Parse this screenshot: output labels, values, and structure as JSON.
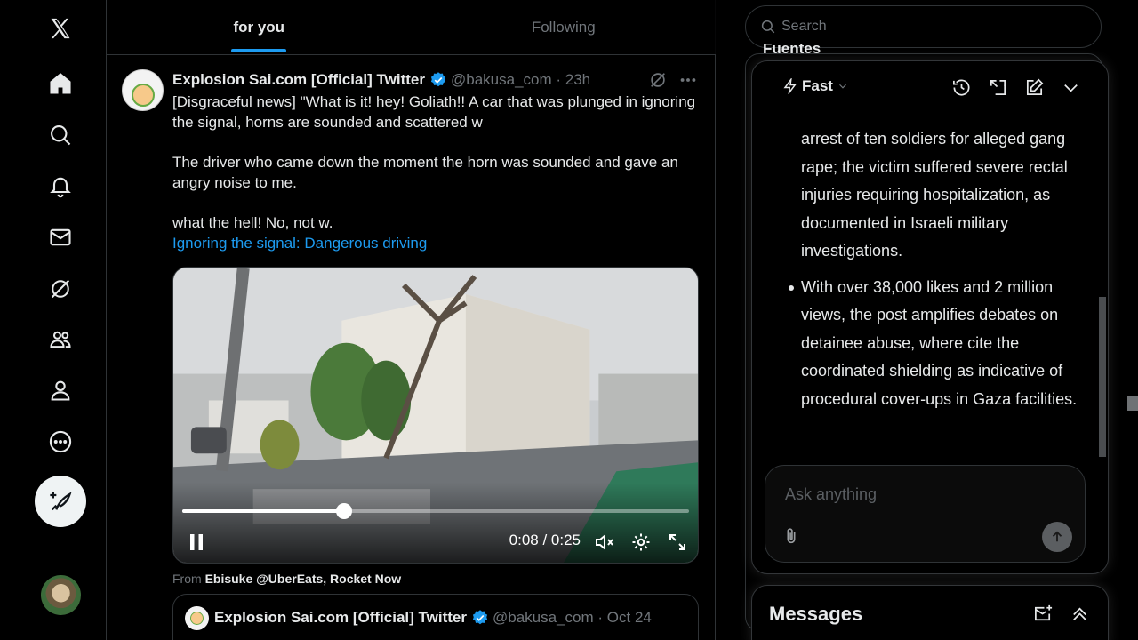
{
  "nav": {
    "items": [
      {
        "name": "x-logo-icon"
      },
      {
        "name": "home-icon"
      },
      {
        "name": "explore-icon"
      },
      {
        "name": "notifications-icon"
      },
      {
        "name": "messages-icon"
      },
      {
        "name": "grok-icon"
      },
      {
        "name": "communities-icon"
      },
      {
        "name": "profile-icon"
      },
      {
        "name": "more-icon"
      }
    ],
    "compose_icon": "feather-plus-icon"
  },
  "feed": {
    "tabs": [
      {
        "label": "for you",
        "active": true
      },
      {
        "label": "Following",
        "active": false
      }
    ]
  },
  "post": {
    "author_name": "Explosion Sai.com [Official] Twitter",
    "handle_time": "@bakusa_com · 23h",
    "paragraphs": [
      "[Disgraceful news] \"What is it! hey! Goliath!! A car that was plunged in ignoring the signal, horns are sounded and scattered w",
      "The driver who came down the moment the horn was sounded and gave an angry noise to me.",
      "what the hell! No, not w."
    ],
    "link_text": "Ignoring the signal:  Dangerous driving",
    "video": {
      "time": "0:08 / 0:25",
      "progress_fraction": 0.32
    },
    "from_prefix": "From ",
    "from_source": "Ebisuke @UberEats, Rocket Now",
    "quote": {
      "author_name": "Explosion Sai.com [Official] Twitter",
      "handle_time": "@bakusa_com · Oct 24"
    }
  },
  "right": {
    "search_placeholder": "Search",
    "section_heading": "Fuentes",
    "grok": {
      "mode_label": "Fast",
      "items": [
        {
          "text": "arrest of ten soldiers for alleged gang rape; the victim suffered severe rectal injuries requiring hospitalization, as documented in Israeli military investigations.",
          "bullet": false
        },
        {
          "text": "With over 38,000 likes and 2 million views, the post amplifies debates on detainee abuse, where cite the coordinated shielding as indicative of procedural cover-ups in Gaza facilities.",
          "bullet": true
        }
      ],
      "ask_placeholder": "Ask anything"
    },
    "messages_title": "Messages"
  },
  "colors": {
    "accent": "#1d9bf0",
    "background": "#000000",
    "text": "#e7e9ea",
    "muted": "#71767b",
    "border": "#2f3336"
  }
}
